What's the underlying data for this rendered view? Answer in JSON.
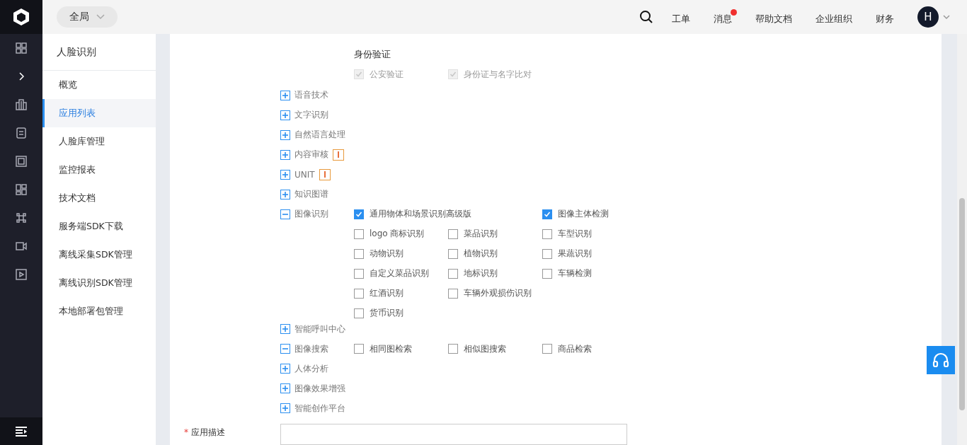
{
  "header": {
    "scope": "全局",
    "nav": [
      {
        "label": "工单",
        "badge": false
      },
      {
        "label": "消息",
        "badge": true
      },
      {
        "label": "帮助文档",
        "badge": false
      },
      {
        "label": "企业组织",
        "badge": false
      },
      {
        "label": "财务",
        "badge": false
      }
    ],
    "avatar": "H"
  },
  "sidebar": {
    "title": "人脸识别",
    "items": [
      {
        "label": "概览",
        "selected": false
      },
      {
        "label": "应用列表",
        "selected": true
      },
      {
        "label": "人脸库管理",
        "selected": false
      },
      {
        "label": "监控报表",
        "selected": false
      },
      {
        "label": "技术文档",
        "selected": false
      },
      {
        "label": "服务端SDK下载",
        "selected": false
      },
      {
        "label": "离线采集SDK管理",
        "selected": false
      },
      {
        "label": "离线识别SDK管理",
        "selected": false
      },
      {
        "label": "本地部署包管理",
        "selected": false
      }
    ]
  },
  "identity": {
    "heading": "身份验证",
    "options": [
      {
        "label": "公安验证",
        "checked": true,
        "disabled": true
      },
      {
        "label": "身份证与名字比对",
        "checked": true,
        "disabled": true
      }
    ]
  },
  "categories": [
    {
      "label": "语音技术",
      "expanded": false,
      "warning": false
    },
    {
      "label": "文字识别",
      "expanded": false,
      "warning": false
    },
    {
      "label": "自然语言处理",
      "expanded": false,
      "warning": false
    },
    {
      "label": "内容审核",
      "expanded": false,
      "warning": true
    },
    {
      "label": "UNIT",
      "expanded": false,
      "warning": true
    },
    {
      "label": "知识图谱",
      "expanded": false,
      "warning": false
    },
    {
      "label": "图像识别",
      "expanded": true,
      "warning": false,
      "options": [
        {
          "label": "通用物体和场景识别高级版",
          "checked": true,
          "wide": true
        },
        {
          "label": "图像主体检测",
          "checked": true
        },
        {
          "label": "logo 商标识别",
          "checked": false
        },
        {
          "label": "菜品识别",
          "checked": false
        },
        {
          "label": "车型识别",
          "checked": false
        },
        {
          "label": "动物识别",
          "checked": false
        },
        {
          "label": "植物识别",
          "checked": false
        },
        {
          "label": "果蔬识别",
          "checked": false
        },
        {
          "label": "自定义菜品识别",
          "checked": false
        },
        {
          "label": "地标识别",
          "checked": false
        },
        {
          "label": "车辆检测",
          "checked": false
        },
        {
          "label": "红酒识别",
          "checked": false
        },
        {
          "label": "车辆外观损伤识别",
          "checked": false,
          "wide": true
        },
        {
          "label": "货币识别",
          "checked": false
        }
      ]
    },
    {
      "label": "智能呼叫中心",
      "expanded": false,
      "warning": false
    },
    {
      "label": "图像搜索",
      "expanded": true,
      "warning": false,
      "options": [
        {
          "label": "相同图检索",
          "checked": false
        },
        {
          "label": "相似图搜索",
          "checked": false
        },
        {
          "label": "商品检索",
          "checked": false
        }
      ]
    },
    {
      "label": "人体分析",
      "expanded": false,
      "warning": false
    },
    {
      "label": "图像效果增强",
      "expanded": false,
      "warning": false
    },
    {
      "label": "智能创作平台",
      "expanded": false,
      "warning": false
    }
  ],
  "description": {
    "label": "应用描述",
    "required_mark": "*"
  }
}
